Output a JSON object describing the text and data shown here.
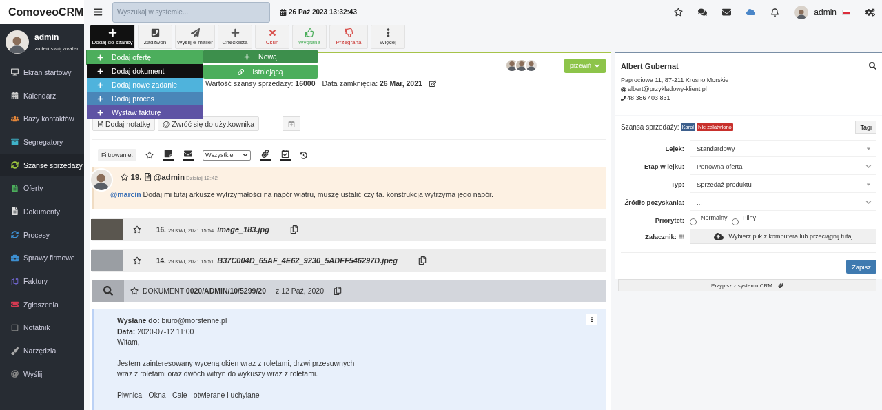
{
  "app": {
    "logo": "ComoveoCRM",
    "search_placeholder": "Wyszukaj w systemie...",
    "datetime": "26 Paź 2023 13:32:43",
    "user": "admin"
  },
  "sidebar": {
    "user": {
      "name": "admin",
      "subtitle": "zmień swój avatar"
    },
    "items": [
      {
        "label": "Ekran startowy",
        "selected": false
      },
      {
        "label": "Kalendarz",
        "selected": false
      },
      {
        "label": "Bazy kontaktów",
        "selected": false
      },
      {
        "label": "Segregatory",
        "selected": false
      },
      {
        "label": "Szanse sprzedaży",
        "selected": true
      },
      {
        "label": "Oferty",
        "selected": false
      },
      {
        "label": "Dokumenty",
        "selected": false
      },
      {
        "label": "Procesy",
        "selected": false
      },
      {
        "label": "Sprawy firmowe",
        "selected": false
      },
      {
        "label": "Faktury",
        "selected": false
      },
      {
        "label": "Zgłoszenia",
        "selected": false
      },
      {
        "label": "Notatnik",
        "selected": false
      },
      {
        "label": "Narzędzia",
        "selected": false
      },
      {
        "label": "Wyślij",
        "selected": false
      }
    ]
  },
  "toolbar": [
    {
      "label": "Dodaj do szansy",
      "kind": "open"
    },
    {
      "label": "Zadzwoń",
      "kind": "phone"
    },
    {
      "label": "Wyślij e-mailer",
      "kind": "send"
    },
    {
      "label": "Checklista",
      "kind": "add"
    },
    {
      "label": "Usuń",
      "kind": "delete"
    },
    {
      "label": "Wygrana",
      "kind": "won"
    },
    {
      "label": "Przegrana",
      "kind": "lost"
    },
    {
      "label": "Więcej",
      "kind": "more"
    }
  ],
  "add_menu": [
    {
      "label": "Dodaj ofertę",
      "color": "#4cae5c",
      "selected": true
    },
    {
      "label": "Dodaj dokument",
      "color": "#111111",
      "selected": false
    },
    {
      "label": "Dodaj nowe zadanie",
      "color": "#4fb3dc",
      "selected": false
    },
    {
      "label": "Dodaj proces",
      "color": "#4a86b8",
      "selected": false
    },
    {
      "label": "Wystaw fakturę",
      "color": "#5e53a4",
      "selected": false
    }
  ],
  "offer_submenu": [
    {
      "label": "Nową",
      "kind": "new"
    },
    {
      "label": "Istniejącą",
      "kind": "link"
    }
  ],
  "deal": {
    "value_label": "Wartość szansy sprzedaży:",
    "value": "16000",
    "close_label": "Data zamknięcia:",
    "close_date": "26 Mar, 2021",
    "scroll_button": "przewiń"
  },
  "note_actions": [
    {
      "label": "Dodaj notatkę",
      "kind": "note"
    },
    {
      "label": "@ Zwróć się do użytkownika",
      "kind": "mention"
    }
  ],
  "filter": {
    "label": "Filtrowanie:",
    "select": "Wszystkie"
  },
  "note": {
    "number": "19.",
    "author": "@admin",
    "time": "Dzisiaj 12:42",
    "mention": "@marcin",
    "text": "Dodaj mi tutaj arkusze wytrzymałości na napór wiatru, muszę ustalić czy ta. konstrukcja wytrzyma jego napór."
  },
  "files": [
    {
      "number": "16.",
      "date": "29 KWI, 2021 15:54",
      "name": "image_183.jpg"
    },
    {
      "number": "14.",
      "date": "29 KWI, 2021 15:51",
      "name": "B37C004D_65AF_4E62_9230_5ADFF546297D.jpeg"
    }
  ],
  "document": {
    "prefix": "DOKUMENT",
    "number": "0020/ADMIN/10/5299/20",
    "date": "z 12 Paź, 2020"
  },
  "email": {
    "to_label": "Wysłane do:",
    "to": "biuro@morstenne.pl",
    "date_label": "Data:",
    "date": "2020-07-12 11:00",
    "paragraphs": [
      [
        "Witam,"
      ],
      [
        "Jestem zainteresowany wyceną okien wraz z roletami, drzwi przesuwnych",
        "wraz z roletami oraz dwóch witryn do wykuszy wraz z roletami."
      ],
      [
        "Piwnica - Okna - Cale - otwierane i uchylane"
      ]
    ]
  },
  "contact": {
    "name": "Albert Gubernat",
    "address": "Paprociowa 11, 87-211 Krosno Morskie",
    "email": "albert@przykladowy-klient.pl",
    "phone": "48 386 403 831"
  },
  "opportunity": {
    "label": "Szansa sprzedaży:",
    "tags": [
      {
        "label": "Karol",
        "color": "#3d5f8c"
      },
      {
        "label": "Nie załatwiono",
        "color": "#c8302c"
      }
    ],
    "tags_button": "Tagi",
    "fields": [
      {
        "label": "Lejek:",
        "value": "Standardowy",
        "kind": "caret"
      },
      {
        "label": "Etap w lejku:",
        "value": "Ponowna oferta",
        "kind": "chevron"
      },
      {
        "label": "Typ:",
        "value": "Sprzedaż produktu",
        "kind": "caret"
      },
      {
        "label": "Źródło pozyskania:",
        "value": "...",
        "kind": "chevron"
      }
    ],
    "priority": {
      "label": "Priorytet:",
      "options": [
        {
          "label": "Normalny",
          "selected": false
        },
        {
          "label": "Pilny",
          "selected": false
        }
      ]
    },
    "attachment": {
      "label": "Załącznik:",
      "dropzone": "Wybierz plik z komputera  lub  przeciągnij tutaj"
    },
    "save": "Zapisz",
    "footer": "Przypisz z systemu CRM"
  }
}
